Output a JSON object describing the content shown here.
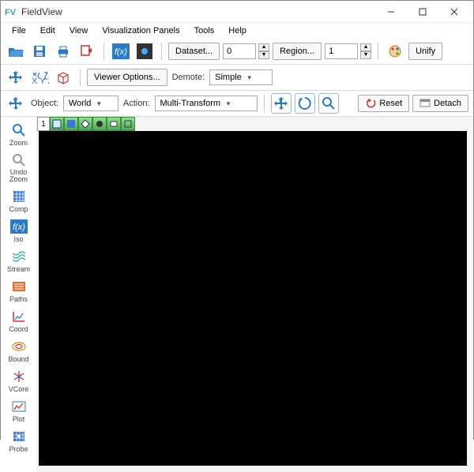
{
  "window": {
    "title": "FieldView"
  },
  "menu": {
    "file": "File",
    "edit": "Edit",
    "view": "View",
    "panels": "Visualization Panels",
    "tools": "Tools",
    "help": "Help"
  },
  "toolbar1": {
    "dataset_label": "Dataset...",
    "dataset_value": "0",
    "region_label": "Region...",
    "region_value": "1",
    "unify": "Unify"
  },
  "toolbar2": {
    "viewer_options": "Viewer Options...",
    "demote_label": "Demote:",
    "demote_value": "Simple"
  },
  "toolbar3": {
    "object_label": "Object:",
    "object_value": "World",
    "action_label": "Action:",
    "action_value": "Multi-Transform",
    "reset": "Reset",
    "detach": "Detach"
  },
  "side": {
    "zoom": "Zoom",
    "undo_zoom": "Undo\nZoom",
    "comp": "Comp",
    "iso": "Iso",
    "stream": "Stream",
    "paths": "Paths",
    "coord": "Coord",
    "bound": "Bound",
    "vcore": "VCore",
    "plot": "Plot",
    "probe": "Probe"
  },
  "viewport": {
    "frame_index": "1"
  },
  "colors": {
    "accent": "#2a7ac7",
    "green": "#5fb85f",
    "orange": "#e07030",
    "teal": "#2aa8a8",
    "red": "#d03030"
  }
}
